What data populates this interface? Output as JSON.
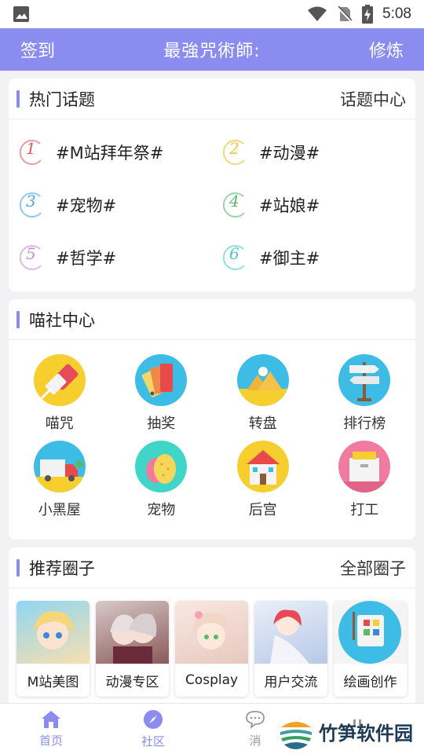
{
  "status_bar": {
    "time": "5:08"
  },
  "header": {
    "left": "签到",
    "title": "最強咒術師:",
    "right": "修炼"
  },
  "hot_topics": {
    "title": "热门话题",
    "link": "话题中心",
    "items": [
      {
        "num": "1",
        "label": "#M站拜年祭#",
        "color": "#e05a5a"
      },
      {
        "num": "2",
        "label": "#动漫#",
        "color": "#f0c640"
      },
      {
        "num": "3",
        "label": "#宠物#",
        "color": "#4aa3e0"
      },
      {
        "num": "4",
        "label": "#站娘#",
        "color": "#5ab86a"
      },
      {
        "num": "5",
        "label": "#哲学#",
        "color": "#c68ae0"
      },
      {
        "num": "6",
        "label": "#御主#",
        "color": "#4ec8c8"
      }
    ]
  },
  "miaoshe": {
    "title": "喵社中心",
    "items": [
      {
        "label": "喵咒",
        "icon": "eraser-icon"
      },
      {
        "label": "抽奖",
        "icon": "color-cards-icon"
      },
      {
        "label": "转盘",
        "icon": "pyramid-icon"
      },
      {
        "label": "排行榜",
        "icon": "signpost-icon"
      },
      {
        "label": "小黑屋",
        "icon": "truck-icon"
      },
      {
        "label": "宠物",
        "icon": "eggs-icon"
      },
      {
        "label": "后宫",
        "icon": "house-icon"
      },
      {
        "label": "打工",
        "icon": "folders-icon"
      }
    ]
  },
  "circles": {
    "title": "推荐圈子",
    "link": "全部圈子",
    "items": [
      {
        "label": "M站美图"
      },
      {
        "label": "动漫专区"
      },
      {
        "label": "Cosplay"
      },
      {
        "label": "用户交流"
      },
      {
        "label": "绘画创作"
      }
    ]
  },
  "bottom_nav": {
    "items": [
      {
        "label": "首页"
      },
      {
        "label": "社区"
      },
      {
        "label": "消"
      }
    ]
  },
  "watermark": {
    "text": "竹笋软件园"
  }
}
